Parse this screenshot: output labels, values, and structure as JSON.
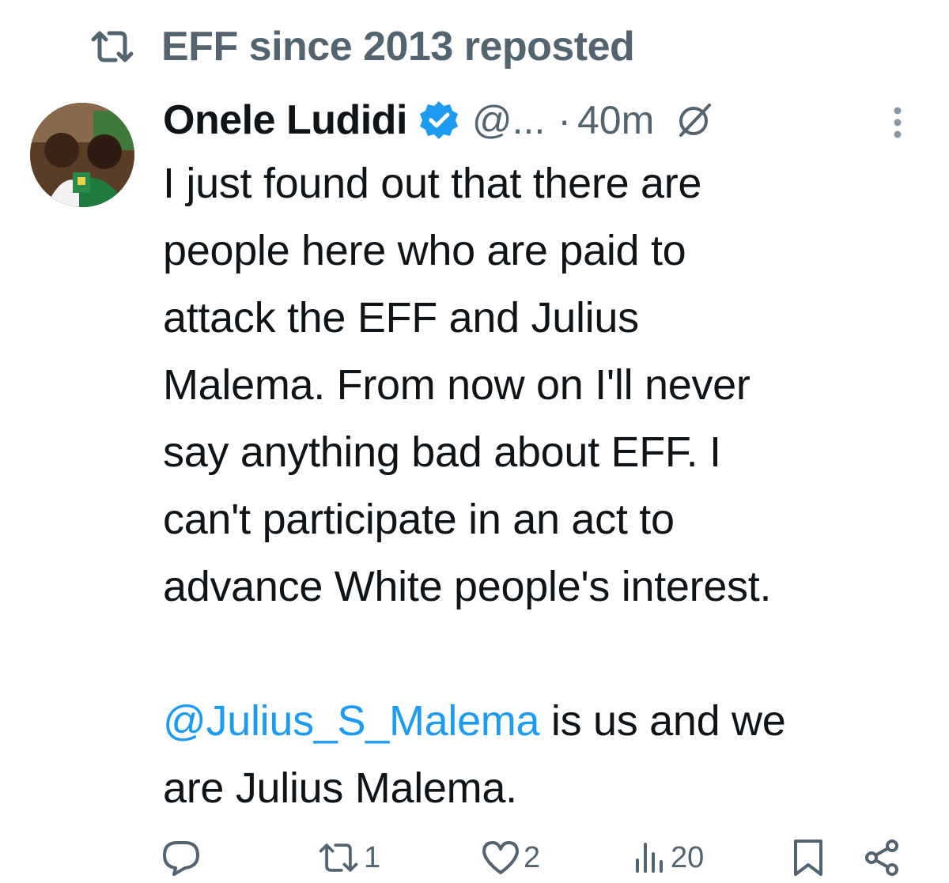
{
  "repost_banner": {
    "icon": "repost-icon",
    "text": "EFF since 2013 reposted"
  },
  "author": {
    "avatar": "avatar-photo",
    "name": "Onele Ludidi",
    "verified": true,
    "handle": "@...",
    "separator": "·",
    "timestamp": "40m"
  },
  "tweet": {
    "text_lines": [
      "I just found out that there are",
      "people here who are paid to",
      "attack the EFF and Julius",
      "Malema. From now on I'll never",
      "say anything bad about EFF. I",
      "can't participate in an act to",
      "advance White people's interest."
    ],
    "mention": "@Julius_S_Malema",
    "after_mention": " is us and we",
    "last_line": "are Julius Malema."
  },
  "actions": {
    "reply_count": "",
    "repost_count": "1",
    "like_count": "2",
    "views_count": "20"
  },
  "colors": {
    "text": "#0f1419",
    "secondary": "#536471",
    "link": "#1d9bf0",
    "verified": "#1d9bf0"
  }
}
